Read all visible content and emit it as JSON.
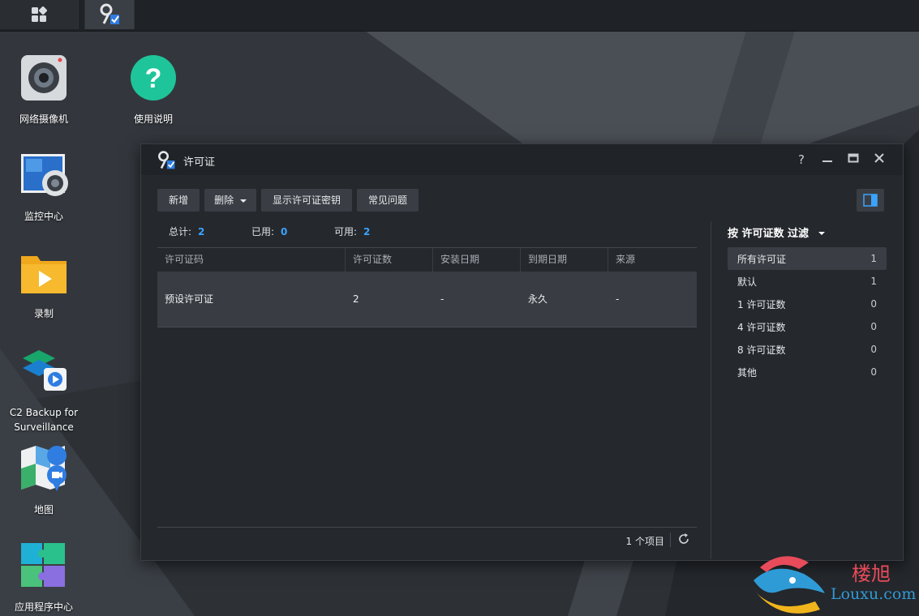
{
  "desktop": {
    "icons": [
      {
        "label": "网络摄像机",
        "icon": "camera-icon"
      },
      {
        "label": "使用说明",
        "icon": "help-icon"
      },
      {
        "label": "监控中心",
        "icon": "monitor-center-icon"
      },
      {
        "label": "录制",
        "icon": "recording-folder-icon"
      },
      {
        "label": "C2 Backup for Surveillance",
        "icon": "c2-backup-icon"
      },
      {
        "label": "地图",
        "icon": "map-icon"
      },
      {
        "label": "应用程序中心",
        "icon": "package-center-icon"
      }
    ]
  },
  "window": {
    "title": "许可证",
    "controls": {
      "help": "?",
      "minimize": "—",
      "maximize": "▭",
      "close": "✕"
    },
    "toolbar": {
      "add": "新增",
      "delete": "删除",
      "show_key": "显示许可证密钥",
      "faq": "常见问题"
    },
    "stats": {
      "total_label": "总计:",
      "total": "2",
      "used_label": "已用:",
      "used": "0",
      "available_label": "可用:",
      "available": "2"
    },
    "table": {
      "columns": [
        "许可证码",
        "许可证数",
        "安装日期",
        "到期日期",
        "来源"
      ],
      "rows": [
        [
          "预设许可证",
          "2",
          "-",
          "永久",
          "-"
        ]
      ]
    },
    "footer": {
      "count": "1 个项目"
    },
    "filter": {
      "title": "按 许可证数 过滤",
      "items": [
        {
          "label": "所有许可证",
          "count": "1"
        },
        {
          "label": "默认",
          "count": "1"
        },
        {
          "label": "1 许可证数",
          "count": "0"
        },
        {
          "label": "4 许可证数",
          "count": "0"
        },
        {
          "label": "8 许可证数",
          "count": "0"
        },
        {
          "label": "其他",
          "count": "0"
        }
      ]
    }
  },
  "watermark": {
    "cn": "楼旭",
    "en": "Louxu.com"
  },
  "colors": {
    "accent": "#3aa3ff",
    "window_bg": "#25282d",
    "row_selected": "#393d43"
  }
}
